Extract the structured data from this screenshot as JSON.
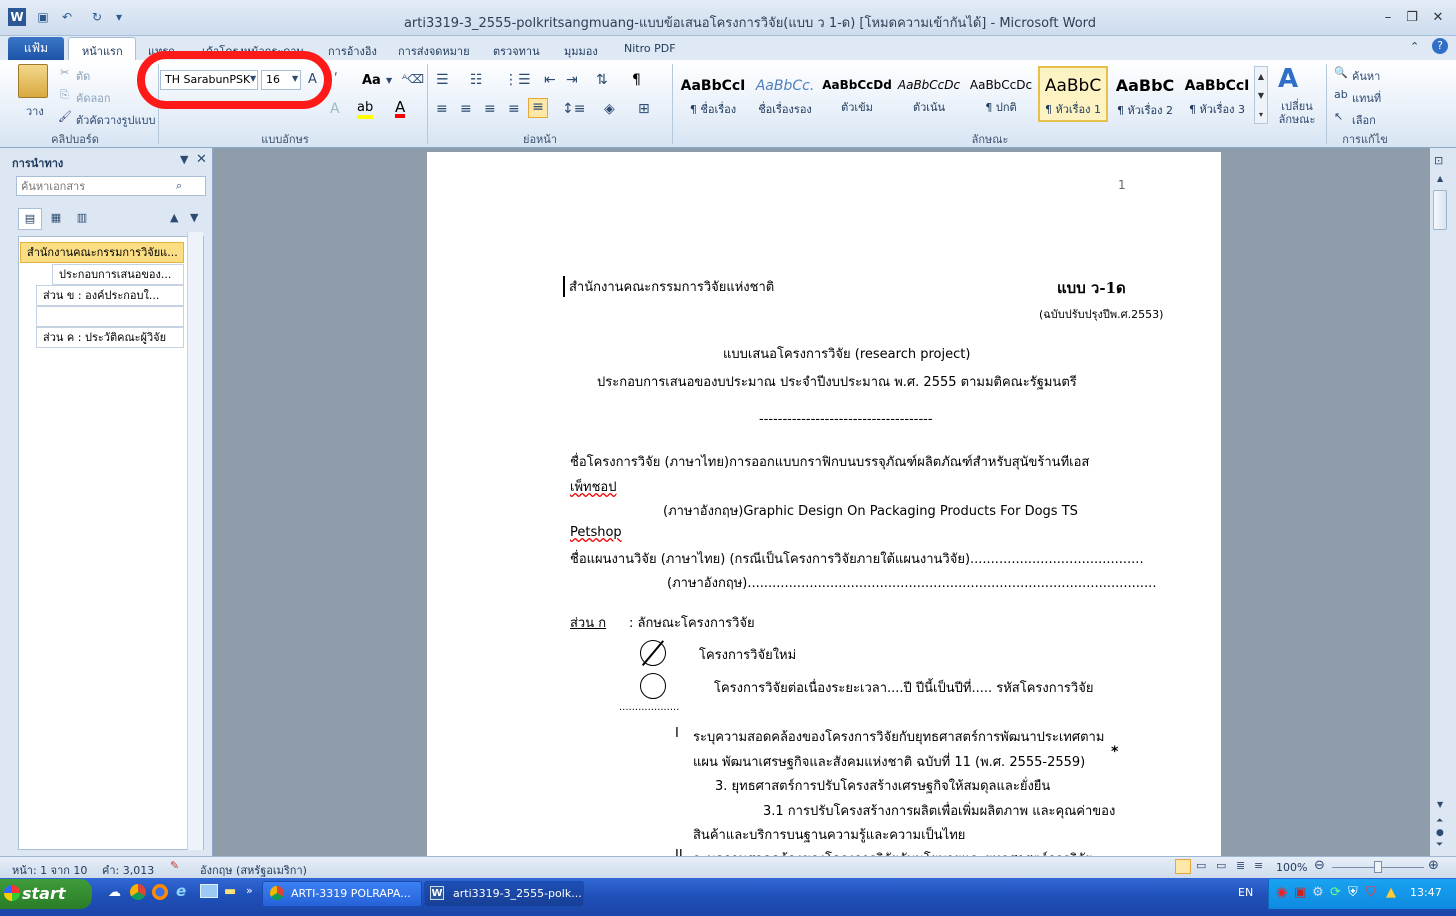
{
  "window": {
    "title": "arti3319-3_2555-polkritsangmuang-แบบข้อเสนอโครงการวิจัย(แบบ ว 1-ด) [โหมดความเข้ากันได้] - Microsoft Word",
    "app_icon": "W"
  },
  "tabs": {
    "file": "แฟ้ม",
    "items": [
      "หน้าแรก",
      "แทรก",
      "เค้าโครงหน้ากระดาษ",
      "การอ้างอิง",
      "การส่งจดหมาย",
      "ตรวจทาน",
      "มุมมอง",
      "Nitro PDF"
    ]
  },
  "ribbon": {
    "clipboard": {
      "paste": "วาง",
      "cut": "ตัด",
      "copy": "คัดลอก",
      "format_painter": "ตัวคัดวางรูปแบบ",
      "label": "คลิปบอร์ด"
    },
    "font": {
      "name": "TH SarabunPSK",
      "size": "16",
      "label": "แบบอักษร",
      "change_case": "Aa",
      "font_color": "A"
    },
    "paragraph": {
      "label": "ย่อหน้า"
    },
    "styles": {
      "label": "ลักษณะ",
      "items": [
        {
          "preview": "AaBbCcI",
          "name": "¶ ชื่อเรื่อง"
        },
        {
          "preview": "AaBbCc.",
          "name": "ชื่อเรื่องรอง"
        },
        {
          "preview": "AaBbCcDd",
          "name": "ตัวเข้ม"
        },
        {
          "preview": "AaBbCcDc",
          "name": "ตัวเน้น"
        },
        {
          "preview": "AaBbCcDc",
          "name": "¶ ปกติ"
        },
        {
          "preview": "AaBbC",
          "name": "¶ หัวเรื่อง 1"
        },
        {
          "preview": "AaBbC",
          "name": "¶ หัวเรื่อง 2"
        },
        {
          "preview": "AaBbCcI",
          "name": "¶ หัวเรื่อง 3"
        }
      ],
      "change_styles": "เปลี่ยน ลักษณะ"
    },
    "editing": {
      "find": "ค้นหา",
      "replace": "แทนที่",
      "select": "เลือก",
      "label": "การแก้ไข"
    }
  },
  "nav": {
    "title": "การนำทาง",
    "search_placeholder": "ค้นหาเอกสาร",
    "items": [
      "สำนักงานคณะกรรมการวิจัยแ...",
      "ประกอบการเสนอของ...",
      "ส่วน  ข   : องค์ประกอบใ...",
      "",
      "ส่วน  ค   : ประวัติคณะผู้วิจัย"
    ]
  },
  "doc": {
    "page_number": "1",
    "org": "สำนักงานคณะกรรมการวิจัยแห่งชาติ",
    "form_code": "แบบ ว-1ด",
    "revision": "(ฉบับปรับปรุงปีพ.ศ.2553)",
    "heading1": "แบบเสนอโครงการวิจัย  (research project)",
    "heading2": "ประกอบการเสนอของบประมาณ  ประจำปีงบประมาณ  พ.ศ. 2555 ตามมติคณะรัฐมนตรี",
    "divider": "-------------------------------------",
    "p1a": "ชื่อโครงการวิจัย (ภาษาไทย)การออกแบบกราฟิกบนบรรจุภัณฑ์ผลิตภัณฑ์สำหรับสุนัขร้านทีเอส",
    "p1b": "เพ็ทชอป",
    "p2a": "(ภาษาอังกฤษ)Graphic   Design   On   Packaging   Products   For   Dogs   TS",
    "p2b": "Petshop",
    "p3": "ชื่อแผนงานวิจัย  (ภาษาไทย)  (กรณีเป็นโครงการวิจัยภายใต้แผนงานวิจัย)..........................................",
    "p4": "(ภาษาอังกฤษ)...................................................................................................",
    "section_a": "ส่วน  ก",
    "section_a_title": ":  ลักษณะโครงการวิจัย",
    "opt_new": "โครงการวิจัยใหม่",
    "opt_cont": "โครงการวิจัยต่อเนื่องระยะเวลา....ปี      ปีนี้เป็นปีที่.....      รหัสโครงการวิจัย",
    "dots": "...................",
    "item1_num": "I",
    "item1a": "ระบุความสอดคล้องของโครงการวิจัยกับยุทธศาสตร์การพัฒนาประเทศตาม",
    "item1b": "แผน  พัฒนาเศรษฐกิจและสังคมแห่งชาติ  ฉบับที่  11  (พ.ศ.  2555-2559)",
    "star": "*",
    "item2": "3.  ยุทธศาสตร์การปรับโครงสร้างเศรษฐกิจให้สมดุลและยั่งยืน",
    "item3a": "3.1   การปรับโครงสร้างการผลิตเพื่อเพิ่มผลิตภาพ และคุณค่าของ",
    "item3b": "สินค้าและบริการบนฐานความรู้และความเป็นไทย",
    "item4_num": "II",
    "item4": "ระบุความสอดคล้องของโครงการวิจัยกับนโยบายและยุทธศาสตร์การวิจัย"
  },
  "status": {
    "page": "หน้า: 1 จาก 10",
    "words": "คำ: 3,013",
    "language": "อังกฤษ (สหรัฐอเมริกา)",
    "zoom": "100%"
  },
  "taskbar": {
    "start": "start",
    "tasks": [
      "ARTI-3319 POLRAPA...",
      "arti3319-3_2555-polk..."
    ],
    "lang": "EN",
    "time": "13:47"
  }
}
